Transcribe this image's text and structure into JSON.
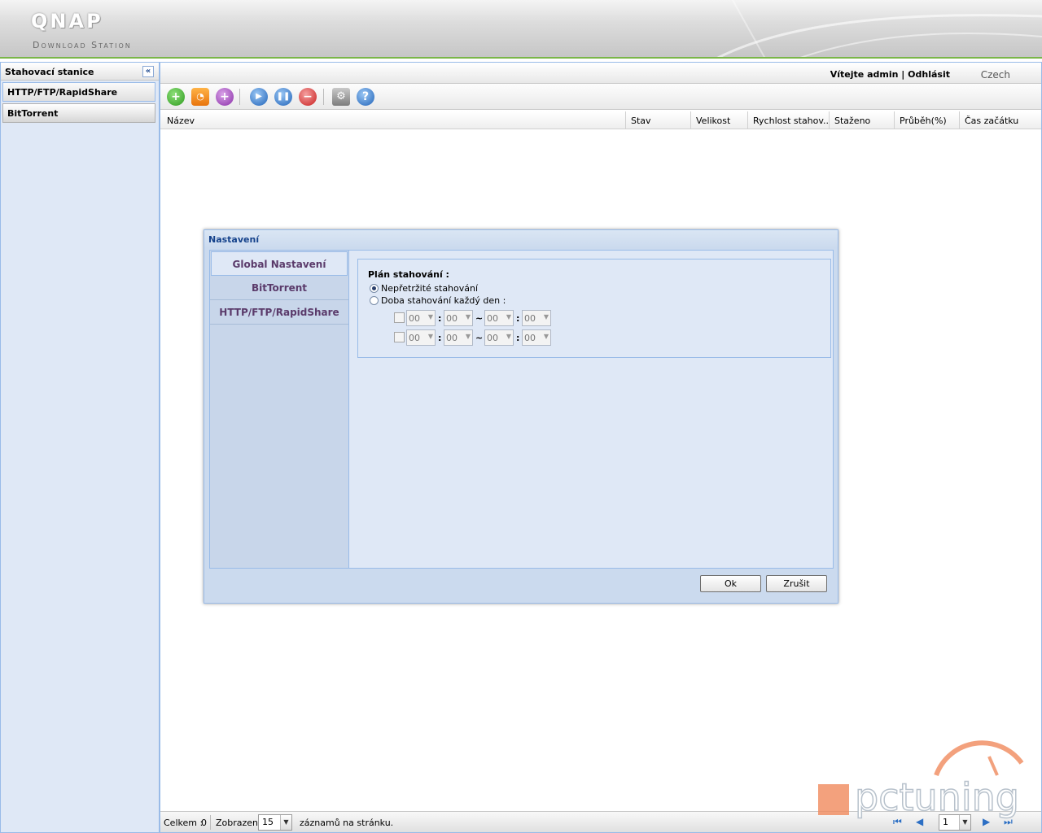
{
  "header": {
    "logo": "QNAP",
    "subtitle": "Download Station"
  },
  "left": {
    "title": "Stahovací stanice",
    "collapse_icon": "«",
    "items": [
      {
        "label": "HTTP/FTP/RapidShare"
      },
      {
        "label": "BitTorrent"
      }
    ]
  },
  "topbar": {
    "welcome_prefix": "Vítejte",
    "user": "admin",
    "separator": "|",
    "logout": "Odhlásit",
    "language": "Czech"
  },
  "toolbar": {
    "icons": [
      "add-download-icon",
      "rss-add-icon",
      "add-purple-icon",
      "start-icon",
      "pause-icon",
      "stop-icon",
      "settings-icon",
      "help-icon"
    ]
  },
  "grid": {
    "columns": [
      "Název",
      "Stav",
      "Velikost",
      "Rychlost stahov...",
      "Staženo",
      "Průběh(%)",
      "Čas začátku"
    ]
  },
  "footer": {
    "total_label": "Celkem :",
    "total": "0",
    "shown_label": "Zobrazeno",
    "page_size": "15",
    "per_page_label": "záznamů na stránku.",
    "page": "1"
  },
  "dialog": {
    "title": "Nastavení",
    "nav": [
      "Global Nastavení",
      "BitTorrent",
      "HTTP/FTP/RapidShare"
    ],
    "schedule_legend": "Plán stahování :",
    "option_continuous": "Nepřetržité stahování",
    "option_daily": "Doba stahování každý den :",
    "time_rows": [
      {
        "h1": "00",
        "m1": "00",
        "h2": "00",
        "m2": "00"
      },
      {
        "h1": "00",
        "m1": "00",
        "h2": "00",
        "m2": "00"
      }
    ],
    "colon": ":",
    "tilde": "~",
    "ok": "Ok",
    "cancel": "Zrušit"
  },
  "watermark": {
    "text": "pctuning"
  },
  "colors": {
    "accent_green": "#7ab648",
    "panel_blue": "#dfe8f6",
    "border_blue": "#99bbe8",
    "title_blue": "#15428b",
    "watermark_orange": "#f08a5d"
  }
}
